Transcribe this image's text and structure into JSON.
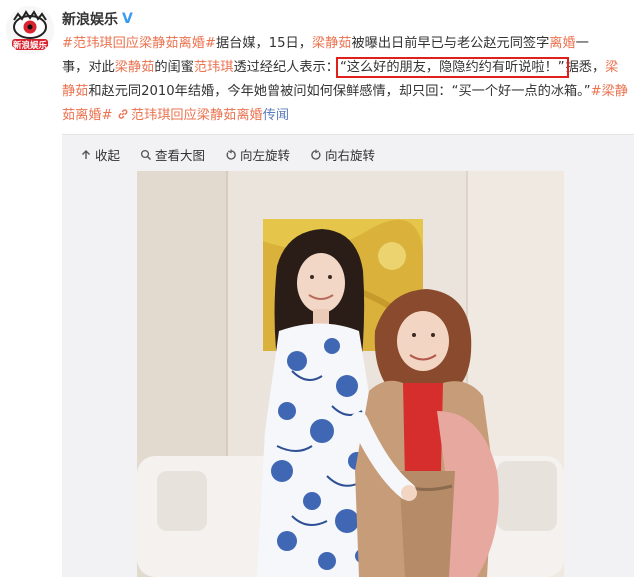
{
  "account": {
    "name": "新浪娱乐",
    "verified_mark": "V",
    "avatar_text": "新浪娱乐"
  },
  "post": {
    "line1": {
      "hashtag": "#范玮琪回应梁静茹离婚#",
      "t1": "据台媒，15日，",
      "name1": "梁静茹",
      "t2": "被曝出日前早已与老公赵元同签字",
      "link1": "离婚",
      "t3": "一"
    },
    "line2": {
      "t1": "事，对此",
      "name1": "梁静茹",
      "t2": "的闺蜜",
      "name2": "范玮琪",
      "t3": "透过经纪人表示：",
      "quote": "“这么好的朋友，隐隐约约有听说啦！”",
      "t4": "据悉，",
      "name3": "梁"
    },
    "line3": {
      "name1": "静茹",
      "t1": "和赵元同2010年结婚，今年她曾被问如何保鲜感情，却只回：“买一个好一点的冰箱。”",
      "hashtag": "#梁静"
    },
    "line4": {
      "hashtag": "茹离婚#",
      "link_title": "范玮琪回应梁静茹离婚",
      "source": "传闻"
    }
  },
  "toolbar": {
    "collapse": "收起",
    "view_large": "查看大图",
    "rotate_left": "向左旋转",
    "rotate_right": "向右旋转"
  },
  "colors": {
    "link": "#eb7350",
    "highlight_box": "#e0201b",
    "verified": "#3a9df0",
    "source": "#5b7cbf"
  },
  "icons": [
    "arrow-up-icon",
    "search-icon",
    "rotate-left-icon",
    "rotate-right-icon",
    "link-chain-icon",
    "verified-icon"
  ]
}
